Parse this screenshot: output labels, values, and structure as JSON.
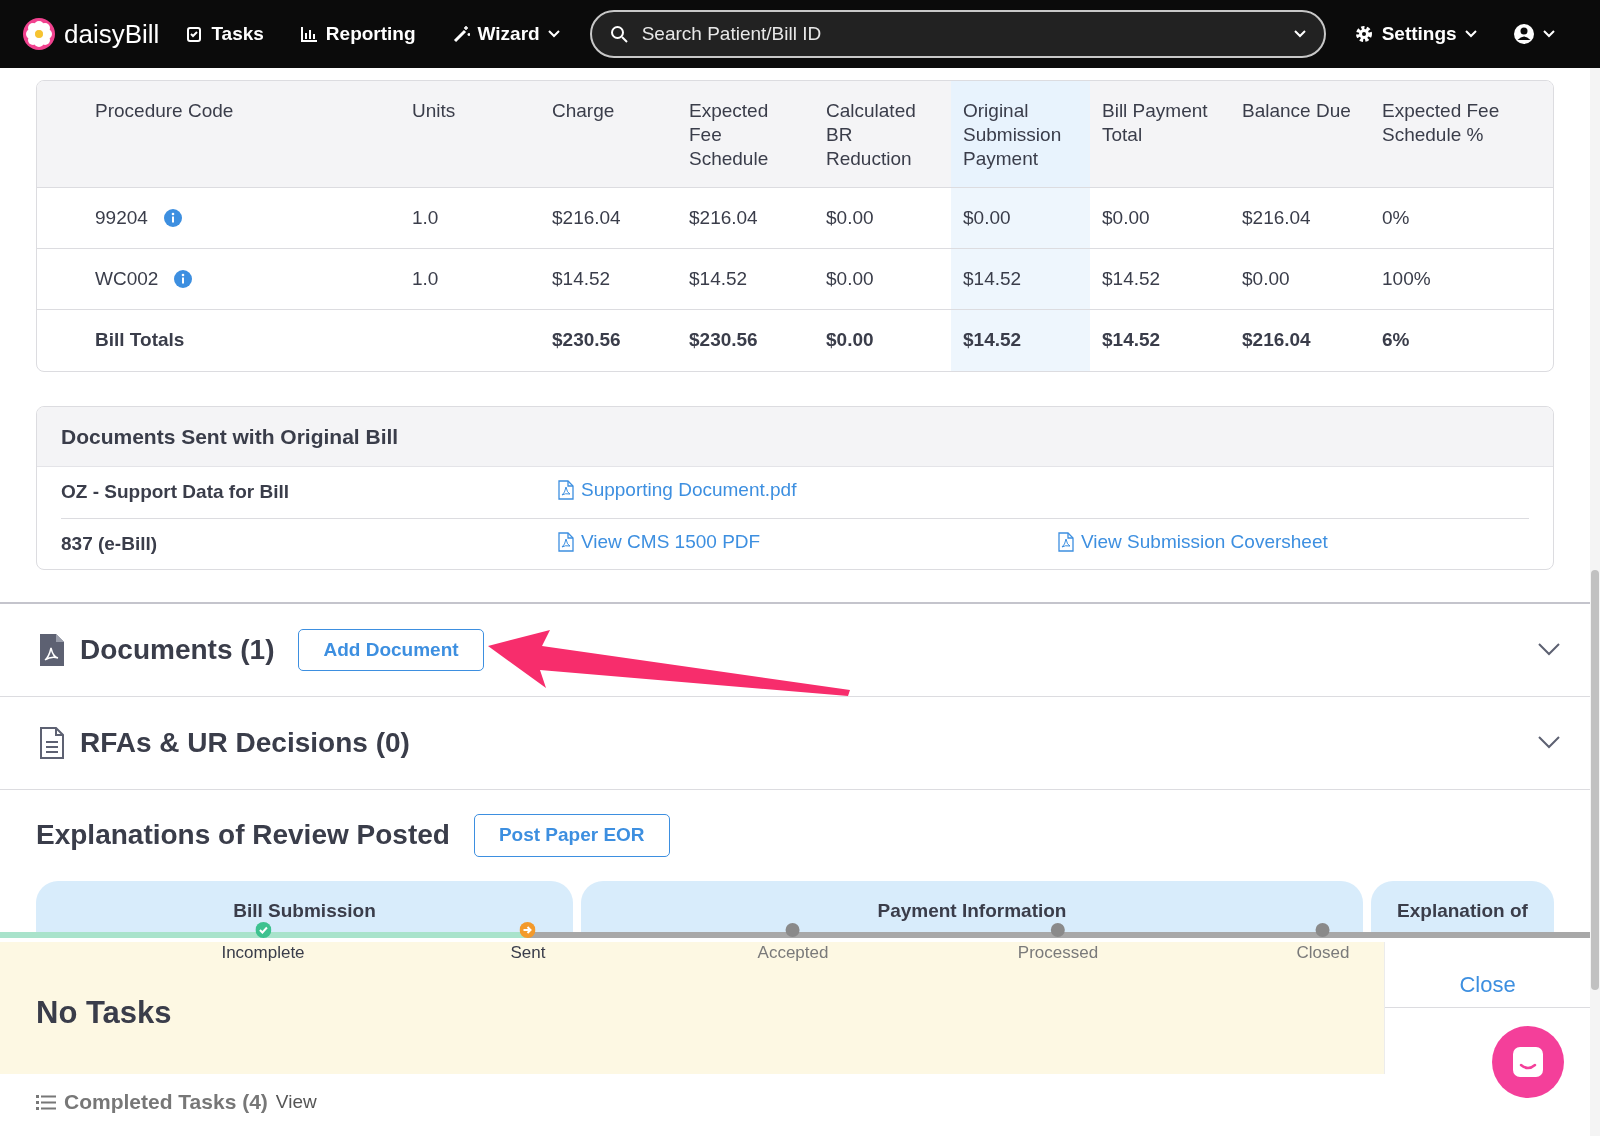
{
  "navbar": {
    "brand": "daisyBill",
    "items": [
      {
        "label": "Tasks",
        "kind": "link"
      },
      {
        "label": "Reporting",
        "kind": "link"
      },
      {
        "label": "Wizard",
        "kind": "dropdown"
      }
    ],
    "search": {
      "placeholder": "Search Patient/Bill ID"
    },
    "settings": "Settings"
  },
  "procedures": {
    "columns": [
      {
        "label": "Procedure Code",
        "highlighted": false
      },
      {
        "label": "Units",
        "highlighted": false
      },
      {
        "label": "Charge",
        "highlighted": false
      },
      {
        "label": "Expected Fee Schedule",
        "highlighted": false
      },
      {
        "label": "Calculated BR Reduction",
        "highlighted": false
      },
      {
        "label": "Original Submission Payment",
        "highlighted": true
      },
      {
        "label": "Bill Payment Total",
        "highlighted": false
      },
      {
        "label": "Balance Due",
        "highlighted": false
      },
      {
        "label": "Expected Fee Schedule %",
        "highlighted": false
      }
    ],
    "rows": [
      {
        "kind": "line",
        "cells": [
          "99204",
          "1.0",
          "$216.04",
          "$216.04",
          "$0.00",
          "$0.00",
          "$0.00",
          "$216.04",
          "0%"
        ]
      },
      {
        "kind": "line",
        "cells": [
          "WC002",
          "1.0",
          "$14.52",
          "$14.52",
          "$0.00",
          "$14.52",
          "$14.52",
          "$0.00",
          "100%"
        ]
      },
      {
        "kind": "total",
        "cells": [
          "Bill Totals",
          "",
          "$230.56",
          "$230.56",
          "$0.00",
          "$14.52",
          "$14.52",
          "$216.04",
          "6%"
        ]
      }
    ]
  },
  "documents_sent": {
    "title": "Documents Sent with Original Bill",
    "rows": [
      {
        "label": "OZ - Support Data for Bill",
        "links": [
          "Supporting Document.pdf"
        ]
      },
      {
        "label": "837 (e-Bill)",
        "links": [
          "View CMS 1500 PDF",
          "View Submission Coversheet"
        ]
      }
    ]
  },
  "sections": [
    {
      "kind": "pdf",
      "title": "Documents (1)",
      "button": "Add Document"
    },
    {
      "kind": "doc",
      "title": "RFAs & UR Decisions (0)"
    }
  ],
  "eor": {
    "title": "Explanations of Review Posted",
    "button": "Post Paper EOR",
    "tabs": [
      "Bill Submission",
      "Payment Information",
      "Explanation of"
    ]
  },
  "progress": [
    {
      "label": "Incomplete",
      "kind": "done"
    },
    {
      "label": "Sent",
      "kind": "current"
    },
    {
      "label": "Accepted",
      "kind": "pending"
    },
    {
      "label": "Processed",
      "kind": "pending"
    },
    {
      "label": "Closed",
      "kind": "pending"
    }
  ],
  "tasks": {
    "message": "No Tasks",
    "close": "Close",
    "completed": "Completed Tasks (4)",
    "view": "View"
  }
}
